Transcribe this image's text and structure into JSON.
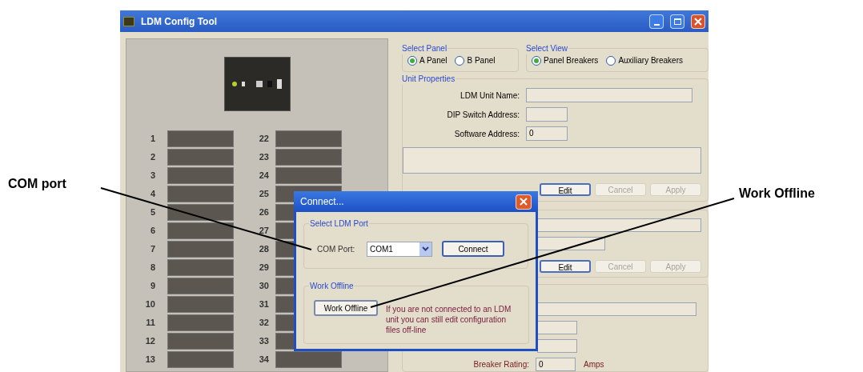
{
  "window": {
    "title": "LDM Config Tool"
  },
  "breaker_panel": {
    "left_numbers": [
      "1",
      "2",
      "3",
      "4",
      "5",
      "6",
      "7",
      "8",
      "9",
      "10",
      "11",
      "12",
      "13"
    ],
    "right_numbers": [
      "22",
      "23",
      "24",
      "25",
      "26",
      "27",
      "28",
      "29",
      "30",
      "31",
      "32",
      "33",
      "34"
    ]
  },
  "select_panel": {
    "title": "Select Panel",
    "options": [
      {
        "label": "A Panel",
        "selected": true
      },
      {
        "label": "B Panel",
        "selected": false
      }
    ]
  },
  "select_view": {
    "title": "Select View",
    "options": [
      {
        "label": "Panel Breakers",
        "selected": true
      },
      {
        "label": "Auxiliary Breakers",
        "selected": false
      }
    ]
  },
  "unit_properties": {
    "title": "Unit Properties",
    "fields": [
      {
        "label": "LDM Unit Name:",
        "kind": "wide"
      },
      {
        "label": "DIP Switch Address:",
        "kind": "short"
      },
      {
        "label": "Software Address:",
        "kind": "short",
        "value": "0"
      }
    ],
    "buttons": [
      {
        "label": "Edit",
        "disabled": false
      },
      {
        "label": "Cancel",
        "disabled": true
      },
      {
        "label": "Apply",
        "disabled": true
      }
    ]
  },
  "second_group": {
    "buttons": [
      {
        "label": "Edit",
        "disabled": false
      },
      {
        "label": "Cancel",
        "disabled": true
      },
      {
        "label": "Apply",
        "disabled": true
      }
    ]
  },
  "breaker_properties": {
    "breaker_rating": {
      "label": "Breaker Rating:",
      "value": "0",
      "unit": "Amps"
    }
  },
  "dialog": {
    "title": "Connect...",
    "port_group": {
      "title": "Select LDM Port",
      "label": "COM Port:",
      "value": "COM1",
      "button": "Connect"
    },
    "offline_group": {
      "title": "Work Offline",
      "button": "Work Offline",
      "text": "If you are not connected to an LDM unit you can still edit configuration files off-line"
    }
  },
  "callouts": [
    {
      "text": "COM port"
    },
    {
      "text": "Work Offline"
    }
  ]
}
